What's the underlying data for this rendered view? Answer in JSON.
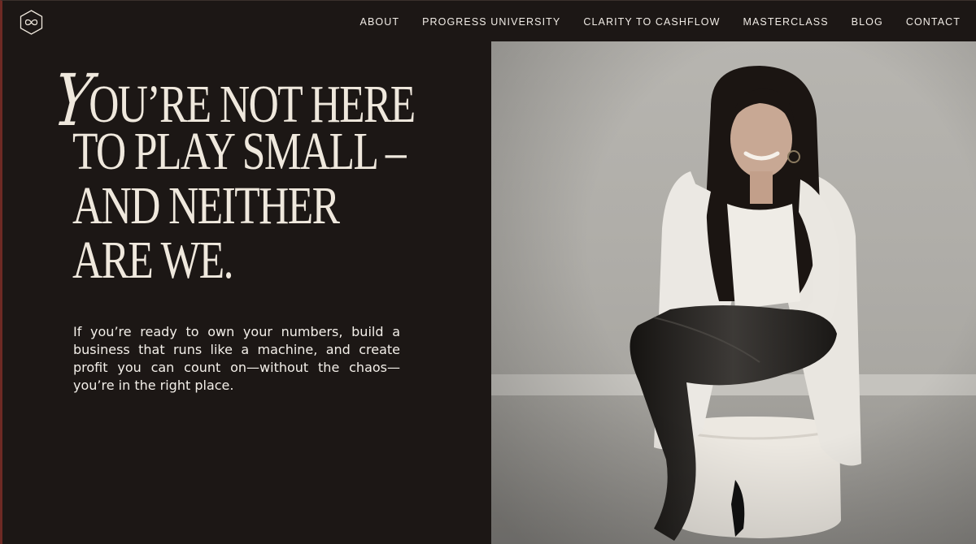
{
  "brand": {
    "logo_icon": "infinity-hexagon-icon"
  },
  "nav": {
    "items": [
      {
        "label": "ABOUT"
      },
      {
        "label": "PROGRESS UNIVERSITY"
      },
      {
        "label": "CLARITY TO CASHFLOW"
      },
      {
        "label": "MASTERCLASS"
      },
      {
        "label": "BLOG"
      },
      {
        "label": "CONTACT"
      }
    ]
  },
  "hero": {
    "headline": {
      "script_initial": "Y",
      "lines": [
        "OU’RE NOT HERE",
        "TO PLAY SMALL –",
        "AND NEITHER",
        "ARE  WE."
      ]
    },
    "body": "If you’re ready to own your numbers, build a business that runs like a machine, and create profit you can count on—without the chaos—you’re in the right place."
  },
  "colors": {
    "background": "#1c1715",
    "headline": "#efe8dd",
    "text": "#f3efe9",
    "accent_edge": "#6e2a24"
  }
}
